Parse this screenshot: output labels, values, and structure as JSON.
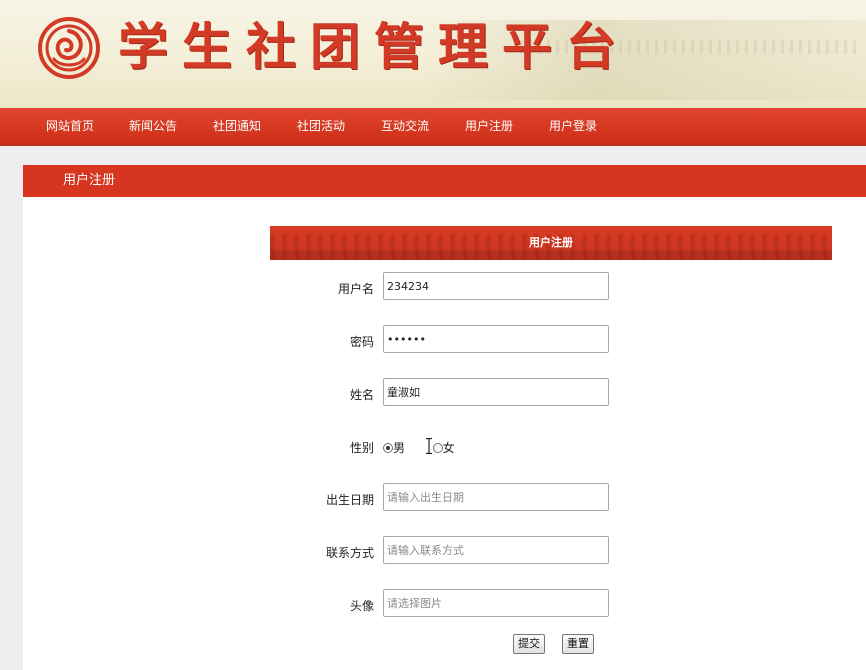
{
  "header": {
    "site_title": "学生社团管理平台",
    "logo": "club-emblem-logo"
  },
  "nav": {
    "items": [
      {
        "label": "网站首页"
      },
      {
        "label": "新闻公告"
      },
      {
        "label": "社团通知"
      },
      {
        "label": "社团活动"
      },
      {
        "label": "互动交流"
      },
      {
        "label": "用户注册"
      },
      {
        "label": "用户登录"
      }
    ]
  },
  "page": {
    "section_title": "用户注册",
    "form_title": "用户注册"
  },
  "form": {
    "username": {
      "label": "用户名",
      "value": "234234"
    },
    "password": {
      "label": "密码",
      "value": "234234"
    },
    "name": {
      "label": "姓名",
      "value": "童淑如"
    },
    "gender": {
      "label": "性别",
      "options": [
        "男",
        "女"
      ],
      "selected": "男"
    },
    "birthdate": {
      "label": "出生日期",
      "value": "",
      "placeholder": "请输入出生日期"
    },
    "contact": {
      "label": "联系方式",
      "value": "",
      "placeholder": "请输入联系方式"
    },
    "avatar": {
      "label": "头像",
      "value": "",
      "placeholder": "请选择图片"
    },
    "submit_label": "提交",
    "reset_label": "重置"
  },
  "colors": {
    "brand_red": "#d6361f",
    "header_bg": "#f3efd8"
  }
}
